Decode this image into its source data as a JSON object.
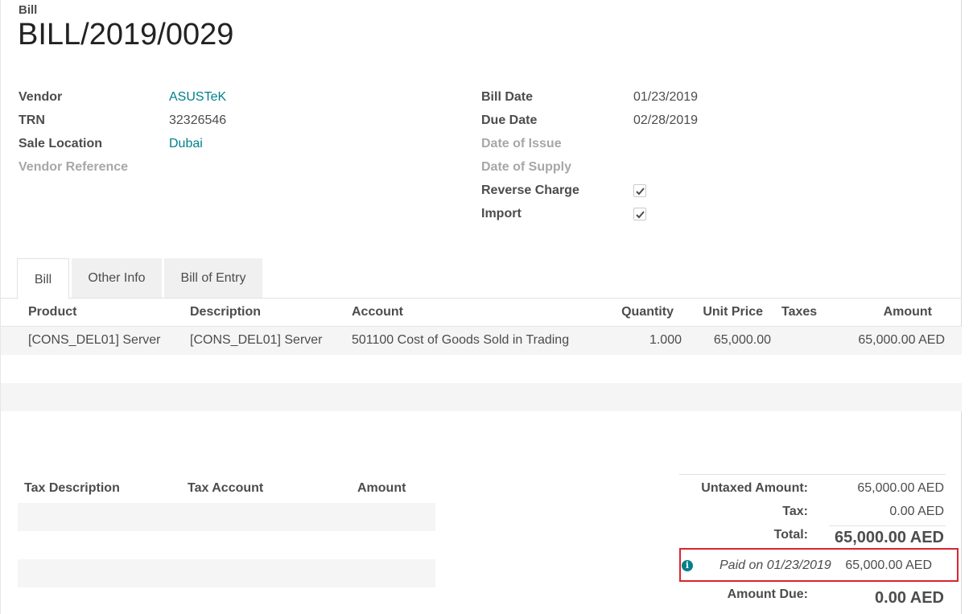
{
  "header": {
    "doc_type": "Bill",
    "doc_name": "BILL/2019/0029"
  },
  "fields_left": {
    "vendor_label": "Vendor",
    "vendor_value": "ASUSTeK",
    "trn_label": "TRN",
    "trn_value": "32326546",
    "sale_location_label": "Sale Location",
    "sale_location_value": "Dubai",
    "vendor_reference_label": "Vendor Reference"
  },
  "fields_right": {
    "bill_date_label": "Bill Date",
    "bill_date_value": "01/23/2019",
    "due_date_label": "Due Date",
    "due_date_value": "02/28/2019",
    "date_of_issue_label": "Date of Issue",
    "date_of_supply_label": "Date of Supply",
    "reverse_charge_label": "Reverse Charge",
    "reverse_charge_checked": true,
    "import_label": "Import",
    "import_checked": true
  },
  "tabs": [
    {
      "label": "Bill",
      "active": true
    },
    {
      "label": "Other Info",
      "active": false
    },
    {
      "label": "Bill of Entry",
      "active": false
    }
  ],
  "lines_table": {
    "columns": [
      "Product",
      "Description",
      "Account",
      "Quantity",
      "Unit Price",
      "Taxes",
      "Amount"
    ],
    "rows": [
      {
        "product": "[CONS_DEL01] Server",
        "description": "[CONS_DEL01] Server",
        "account": "501100 Cost of Goods Sold in Trading",
        "quantity": "1.000",
        "unit_price": "65,000.00",
        "taxes": "",
        "amount": "65,000.00 AED"
      }
    ]
  },
  "tax_table": {
    "columns": [
      "Tax Description",
      "Tax Account",
      "Amount"
    ]
  },
  "totals": {
    "untaxed_label": "Untaxed Amount:",
    "untaxed_value": "65,000.00 AED",
    "tax_label": "Tax:",
    "tax_value": "0.00 AED",
    "total_label": "Total:",
    "total_value": "65,000.00 AED",
    "paid_label": "Paid on 01/23/2019",
    "paid_value": "65,000.00 AED",
    "amount_due_label": "Amount Due:",
    "amount_due_value": "0.00 AED"
  },
  "colors": {
    "link": "#00808a",
    "highlight_border": "#d9242f",
    "row_stripe": "#f5f5f5"
  }
}
